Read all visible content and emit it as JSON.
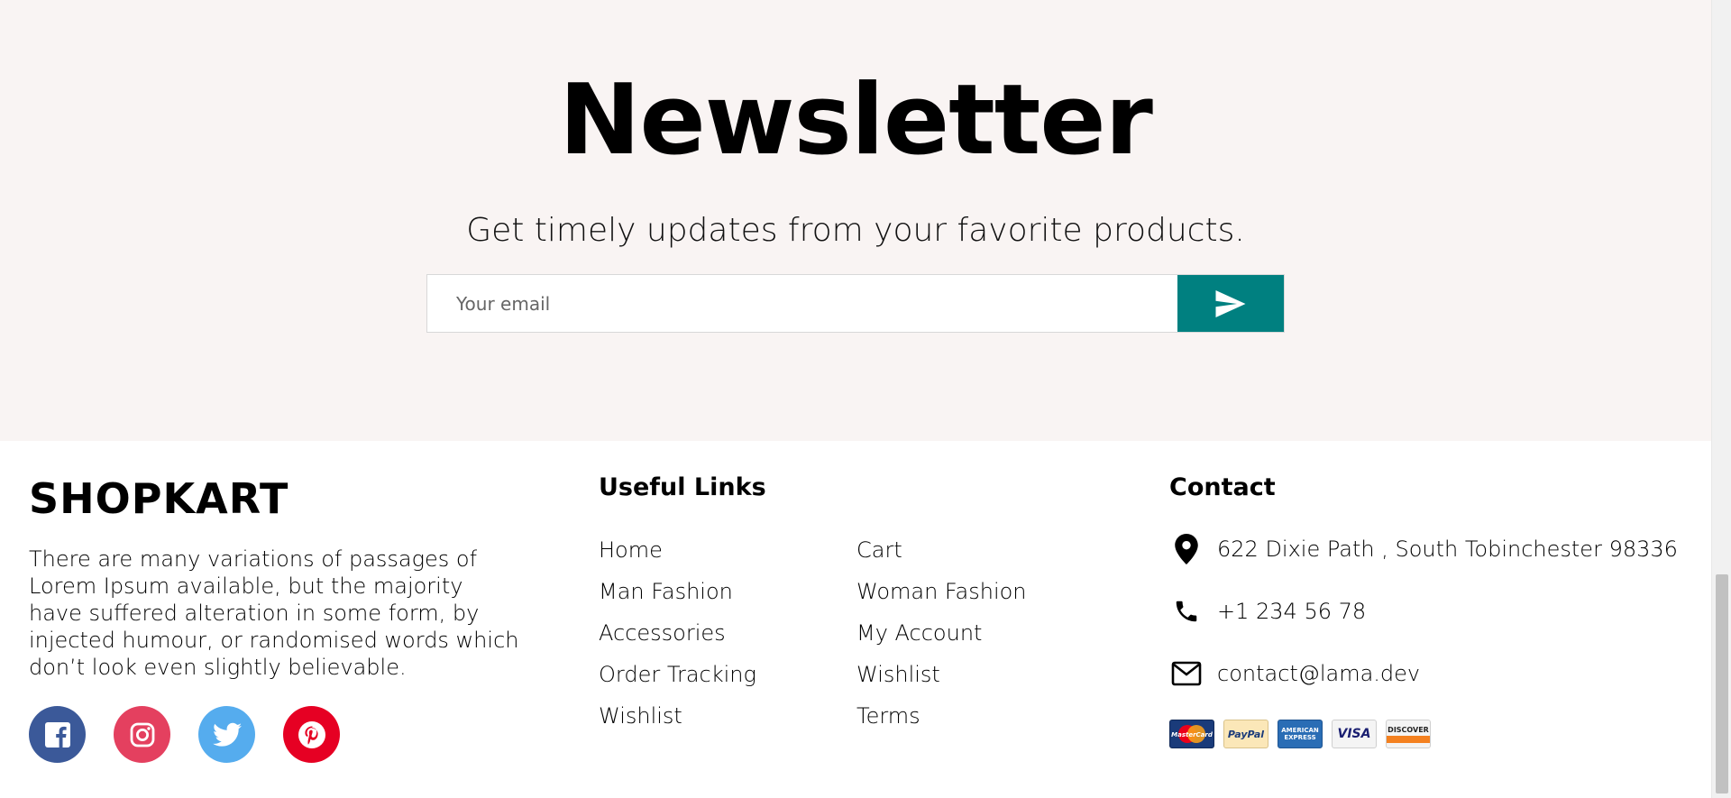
{
  "newsletter": {
    "title": "Newsletter",
    "description": "Get timely updates from your favorite products.",
    "email_placeholder": "Your email",
    "submit_icon": "send-icon",
    "button_color": "#008080"
  },
  "footer": {
    "brand": {
      "logo": "SHOPKART",
      "description": "There are many variations of passages of Lorem Ipsum available, but the majority have suffered alteration in some form, by injected humour, or randomised words which don’t look even slightly believable.",
      "socials": [
        {
          "icon": "facebook-icon",
          "color": "#3b5999"
        },
        {
          "icon": "instagram-icon",
          "color": "#e4405f"
        },
        {
          "icon": "twitter-icon",
          "color": "#55acee"
        },
        {
          "icon": "pinterest-icon",
          "color": "#e60023"
        }
      ]
    },
    "useful_links": {
      "heading": "Useful Links",
      "items": [
        "Home",
        "Cart",
        "Man Fashion",
        "Woman Fashion",
        "Accessories",
        "My Account",
        "Order Tracking",
        "Wishlist",
        "Wishlist",
        "Terms"
      ]
    },
    "contact": {
      "heading": "Contact",
      "address": "622 Dixie Path , South Tobinchester 98336",
      "phone": "+1 234 56 78",
      "email": "contact@lama.dev",
      "payments": [
        {
          "label": "MasterCard",
          "icon": "mastercard-icon"
        },
        {
          "label": "PayPal",
          "icon": "paypal-icon"
        },
        {
          "label": "AMERICAN EXPRESS",
          "icon": "amex-icon"
        },
        {
          "label": "VISA",
          "icon": "visa-icon"
        },
        {
          "label": "DISCOVER",
          "icon": "discover-icon"
        }
      ]
    }
  }
}
